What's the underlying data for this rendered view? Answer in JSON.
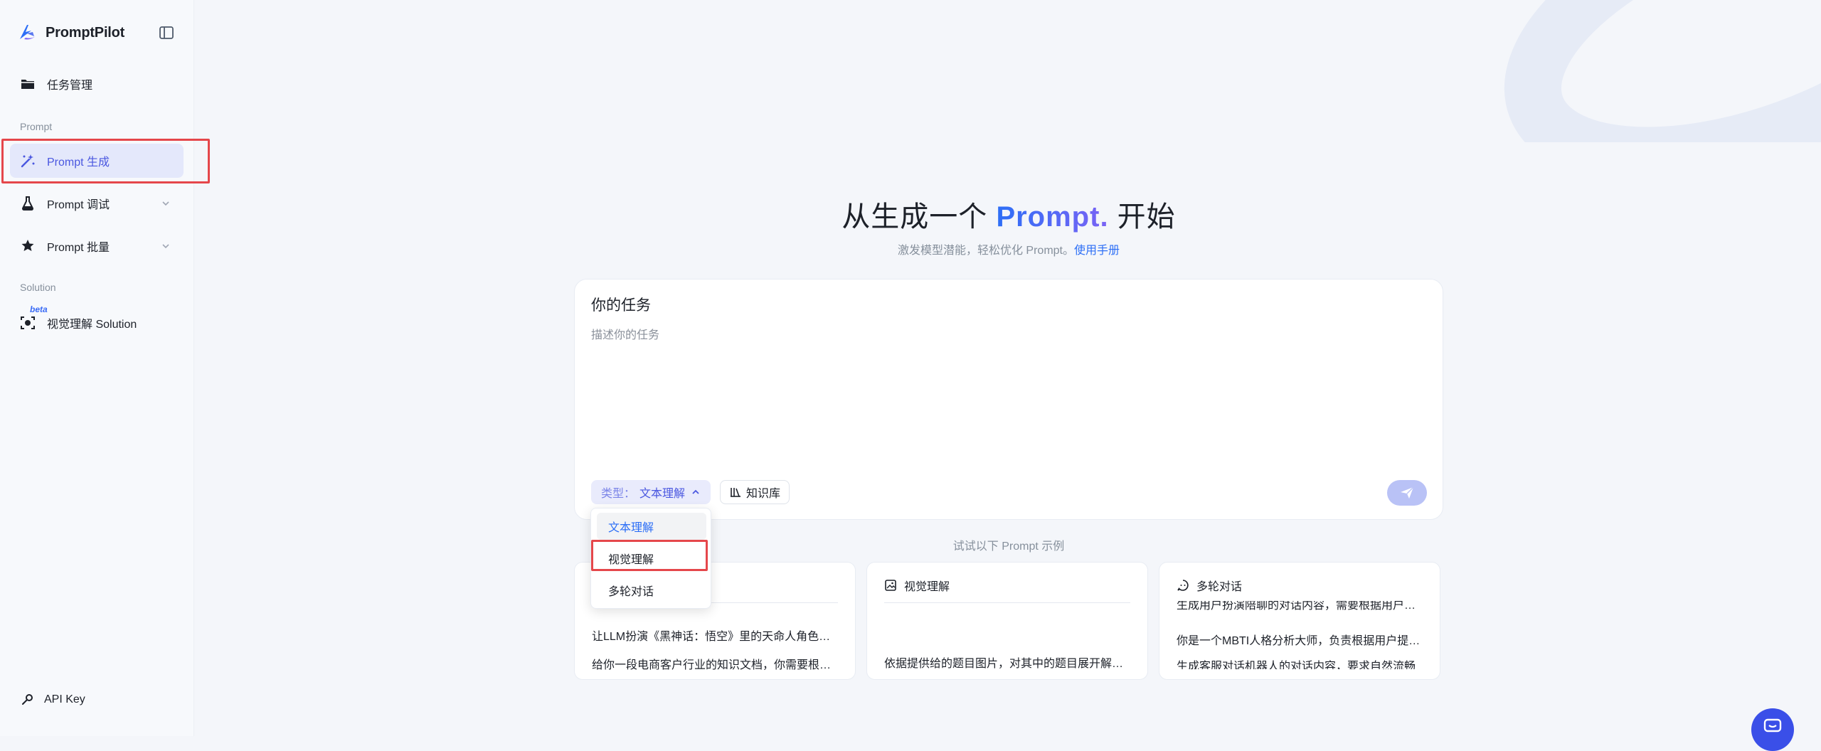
{
  "sidebar": {
    "brand": "PromptPilot",
    "task_mgmt": "任务管理",
    "section_prompt": "Prompt",
    "prompt_generate": "Prompt 生成",
    "prompt_debug": "Prompt 调试",
    "prompt_batch": "Prompt 批量",
    "section_solution": "Solution",
    "beta_badge": "beta",
    "vision_solution": "视觉理解 Solution",
    "api_key": "API Key"
  },
  "hero": {
    "title_pre": "从生成一个 ",
    "title_accent": "Prompt.",
    "title_post": " 开始",
    "subtitle": "激发模型潜能，轻松优化 Prompt。",
    "manual_link": "使用手册"
  },
  "task": {
    "title": "你的任务",
    "placeholder": "描述你的任务",
    "type_label": "类型：",
    "type_value": "文本理解",
    "knowledge_button": "知识库"
  },
  "dropdown": {
    "options": [
      "文本理解",
      "视觉理解",
      "多轮对话"
    ],
    "selected": "文本理解"
  },
  "examples": {
    "label": "试试以下 Prompt 示例",
    "cards": [
      {
        "title": "",
        "lines": [
          "让LLM扮演《黑神话：悟空》里的天命人角色，根据用户的提问进行回复",
          "给你一段电商客户行业的知识文档，你需要根据文档回答用户的问题"
        ]
      },
      {
        "title": "视觉理解",
        "lines": [
          "依据提供给的题目图片，对其中的题目展开解答并给出详细步骤"
        ]
      },
      {
        "title": "多轮对话",
        "lines": [
          "生成用户扮演陪聊的对话内容，需要根据用户，持续进行回复",
          "你是一个MBTI人格分析大师，负责根据用户提供的信息进行分析",
          "生成客服对话机器人的对话内容，要求自然流畅"
        ]
      }
    ]
  },
  "colors": {
    "accent": "#2d6ff6",
    "active_nav_bg": "#e4e8fb",
    "highlight": "#e5474b"
  }
}
